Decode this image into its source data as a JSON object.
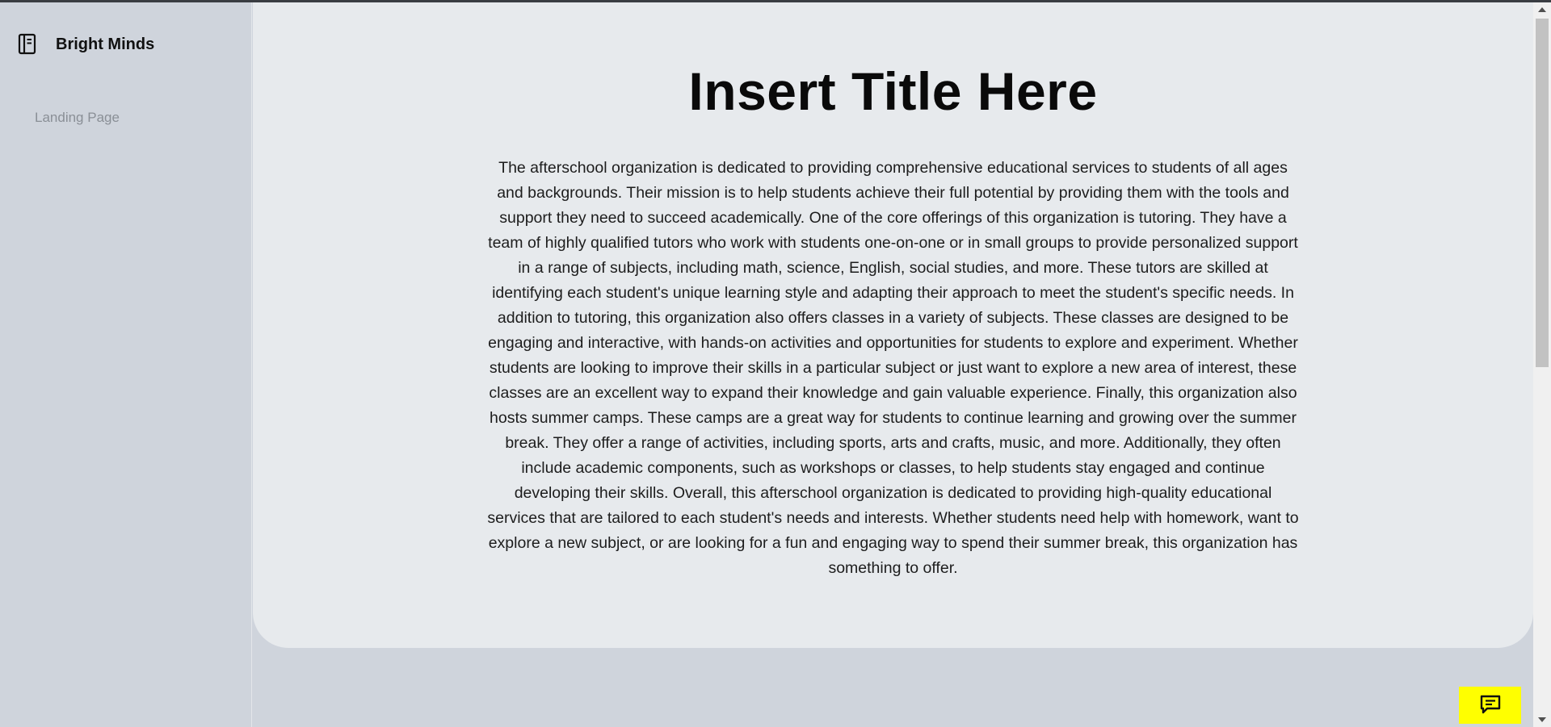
{
  "sidebar": {
    "brand_name": "Bright Minds",
    "brand_icon": "book-icon",
    "items": [
      {
        "label": "Landing Page"
      }
    ]
  },
  "main": {
    "title": "Insert Title Here",
    "body": "The afterschool organization is dedicated to providing comprehensive educational services to students of all ages and backgrounds. Their mission is to help students achieve their full potential by providing them with the tools and support they need to succeed academically. One of the core offerings of this organization is tutoring. They have a team of highly qualified tutors who work with students one-on-one or in small groups to provide personalized support in a range of subjects, including math, science, English, social studies, and more. These tutors are skilled at identifying each student's unique learning style and adapting their approach to meet the student's specific needs. In addition to tutoring, this organization also offers classes in a variety of subjects. These classes are designed to be engaging and interactive, with hands-on activities and opportunities for students to explore and experiment. Whether students are looking to improve their skills in a particular subject or just want to explore a new area of interest, these classes are an excellent way to expand their knowledge and gain valuable experience. Finally, this organization also hosts summer camps. These camps are a great way for students to continue learning and growing over the summer break. They offer a range of activities, including sports, arts and crafts, music, and more. Additionally, they often include academic components, such as workshops or classes, to help students stay engaged and continue developing their skills. Overall, this afterschool organization is dedicated to providing high-quality educational services that are tailored to each student's needs and interests. Whether students need help with homework, want to explore a new subject, or are looking for a fun and engaging way to spend their summer break, this organization has something to offer."
  },
  "chat": {
    "icon": "chat-icon"
  },
  "colors": {
    "sidebar_bg": "#cfd4dc",
    "card_bg": "#e7eaed",
    "chat_button_bg": "#ffff00",
    "nav_text": "#8a8f96"
  }
}
